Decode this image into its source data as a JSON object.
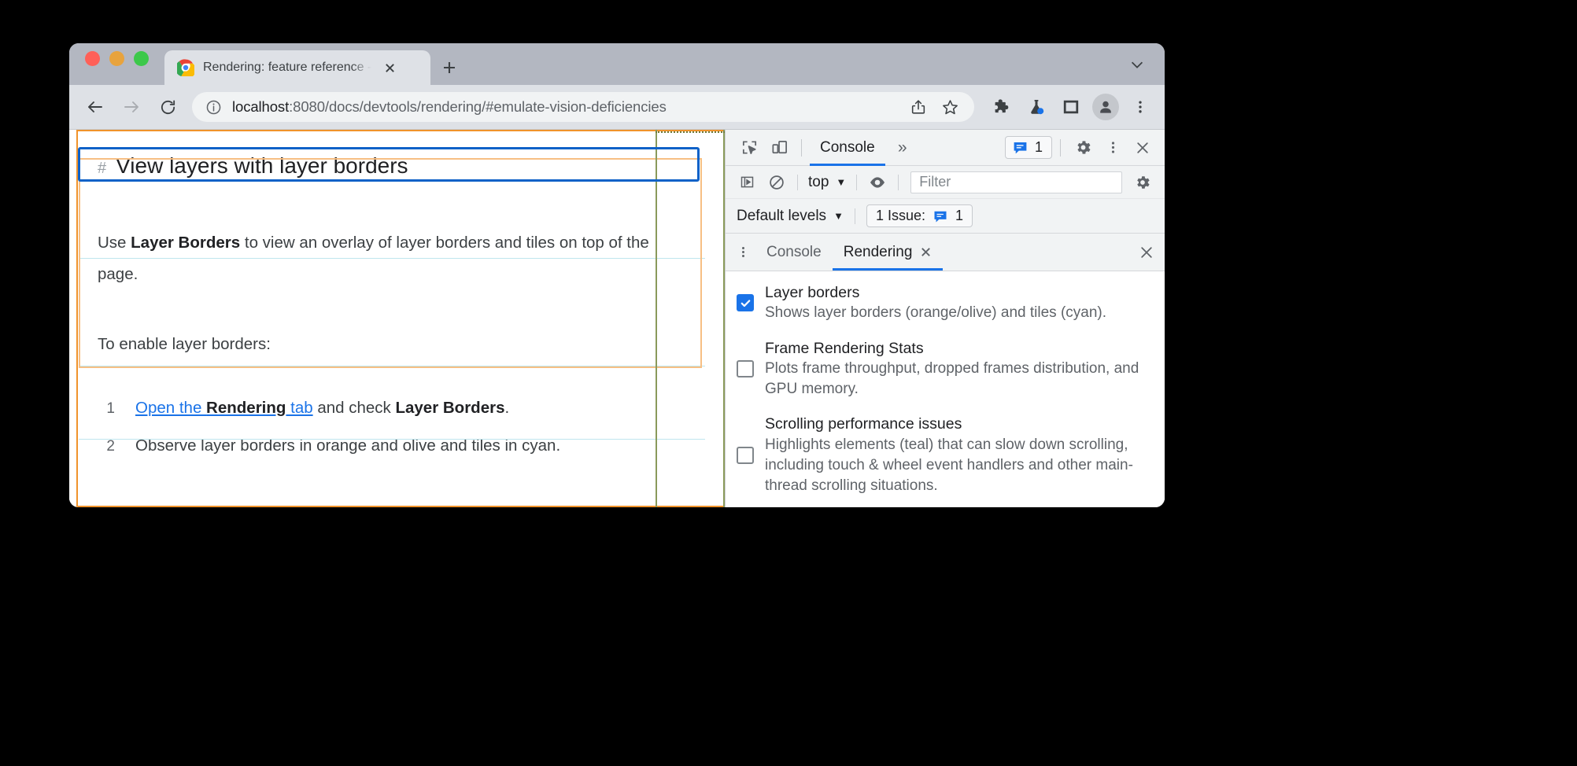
{
  "window": {
    "traffic_lights": [
      "close",
      "minimize",
      "maximize"
    ],
    "chevron": "⌄"
  },
  "tab": {
    "title": "Rendering: feature reference -",
    "close_label": "✕",
    "new_tab_label": "+"
  },
  "toolbar": {
    "back": "←",
    "forward": "→",
    "reload": "⟳",
    "url_host": "localhost",
    "url_path": ":8080/docs/devtools/rendering/#emulate-vision-deficiencies",
    "url_full": "localhost:8080/docs/devtools/rendering/#emulate-vision-deficiencies",
    "icons": [
      "share-icon",
      "bookmark-star-icon",
      "extensions-puzzle-icon",
      "experiments-flask-icon",
      "side-panel-icon",
      "profile-avatar-icon",
      "browser-menu-icon"
    ]
  },
  "page": {
    "heading_anchor": "#",
    "heading": "View layers with layer borders",
    "paragraph_1_pre": "Use ",
    "paragraph_1_bold": "Layer Borders",
    "paragraph_1_post": " to view an overlay of layer borders and tiles on top of the page.",
    "paragraph_2": "To enable layer borders:",
    "steps": [
      {
        "num": "1",
        "link_pre": "Open the ",
        "link_bold": "Rendering",
        "link_post": " tab",
        "after_pre": " and check ",
        "after_bold": "Layer Borders",
        "after_post": "."
      },
      {
        "num": "2",
        "text": "Observe layer borders in orange and olive and tiles in cyan."
      }
    ]
  },
  "devtools": {
    "main_toolbar": {
      "inspect_tooltip": "inspect-element",
      "device_tooltip": "device-toolbar",
      "panels": [
        "Console"
      ],
      "more_panels": "»",
      "issues_count": "1",
      "settings": "gear",
      "kebab": "kebab",
      "close": "✕"
    },
    "console_toolbar": {
      "sidebar_toggle": "console-sidebar-icon",
      "clear_console": "clear-console-icon",
      "context": "top",
      "context_caret": "▼",
      "eye": "live-expression-icon",
      "filter_placeholder": "Filter",
      "settings": "console-settings-icon"
    },
    "levels_bar": {
      "levels_label": "Default levels",
      "levels_caret": "▼",
      "issues_label": "1 Issue:",
      "issues_count": "1"
    },
    "drawer_tabs": {
      "kebab": "⋮",
      "tabs": [
        {
          "label": "Console",
          "active": false,
          "closable": false
        },
        {
          "label": "Rendering",
          "active": true,
          "closable": true
        }
      ],
      "tab_close": "✕",
      "drawer_close": "✕"
    },
    "rendering_options": [
      {
        "title": "Layer borders",
        "desc": "Shows layer borders (orange/olive) and tiles (cyan).",
        "checked": true
      },
      {
        "title": "Frame Rendering Stats",
        "desc": "Plots frame throughput, dropped frames distribution, and GPU memory.",
        "checked": false
      },
      {
        "title": "Scrolling performance issues",
        "desc": "Highlights elements (teal) that can slow down scrolling, including touch & wheel event handlers and other main-thread scrolling situations.",
        "checked": false
      }
    ]
  },
  "colors": {
    "accent_blue": "#1a73e8",
    "layer_border_orange": "#f0932b",
    "tile_border_olive": "#8a9a5b",
    "tile_cyan": "#bfe6ee",
    "link_blue": "#1a73e8"
  }
}
